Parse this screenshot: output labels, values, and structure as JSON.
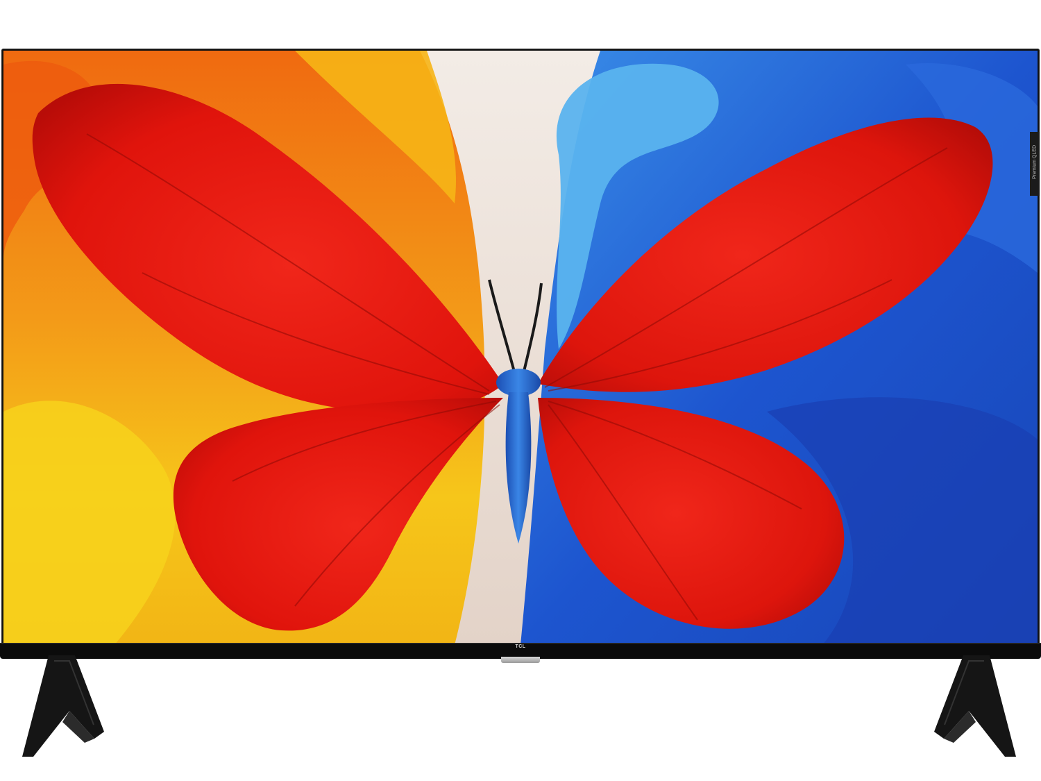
{
  "product": {
    "brand_logo": "TCL",
    "side_badge": "Premium QLED"
  },
  "artwork": {
    "subject": "butterfly-icon",
    "colors": {
      "wing_red": "#e3170d",
      "left_orange": "#f07a12",
      "left_yellow": "#f6c91a",
      "center_cream": "#efe4dd",
      "right_blue": "#1f5fd6",
      "right_light_blue": "#5ab3ee",
      "body_blue": "#2b74d8"
    }
  }
}
